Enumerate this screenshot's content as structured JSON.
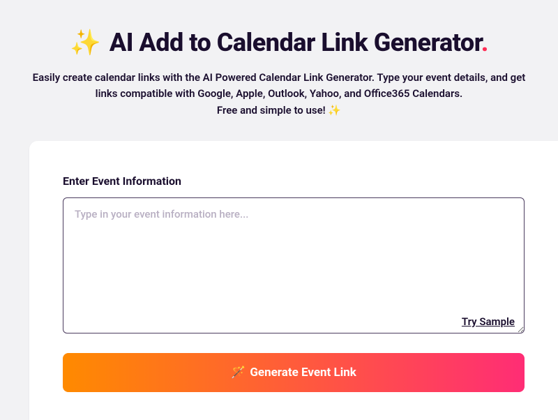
{
  "header": {
    "sparkle_icon": "✨",
    "title_text": "AI Add to Calendar Link Generator",
    "title_dot": ".",
    "subtitle_line1": "Easily create calendar links with the AI Powered Calendar Link Generator. Type your event details, and get",
    "subtitle_line2": "links compatible with Google, Apple, Outlook, Yahoo, and Office365 Calendars.",
    "subtitle_line3": "Free and simple to use! ✨"
  },
  "form": {
    "label": "Enter Event Information",
    "placeholder": "Type in your event information here...",
    "value": "",
    "try_sample_label": "Try Sample",
    "generate_icon": "🪄",
    "generate_label": "Generate Event Link"
  }
}
